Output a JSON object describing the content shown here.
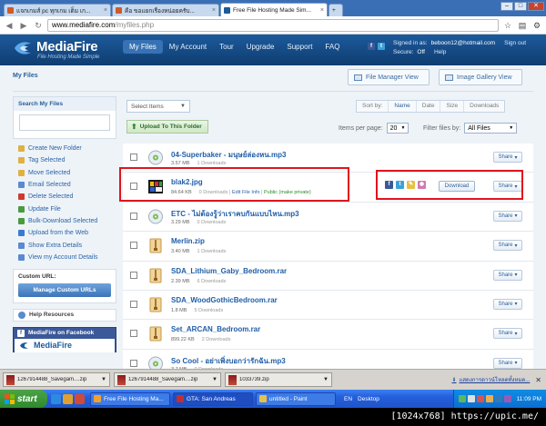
{
  "browser": {
    "tabs": [
      {
        "label": "แจกเกมส์ pc ทุกเกม เต็ม เก...",
        "icon": "forum-icon",
        "color": "#d05a2a"
      },
      {
        "label": "คือ ขอแยกเรื่องหน่อยครับ...",
        "icon": "forum-icon",
        "color": "#d05a2a"
      },
      {
        "label": "Free File Hosting Made Sim...",
        "icon": "mediafire-icon",
        "color": "#1c5a9c"
      }
    ],
    "url_host": "www.mediafire.com",
    "url_path": "/myfiles.php",
    "window_buttons": {
      "minimize": "–",
      "maximize": "□",
      "close": "✕"
    }
  },
  "header": {
    "logo_name": "MediaFire",
    "logo_tagline": "File Hosting Made Simple",
    "nav": [
      "My Files",
      "My Account",
      "Tour",
      "Upgrade",
      "Support",
      "FAQ"
    ],
    "active_nav": "My Files",
    "signed_in_label": "Signed in as:",
    "signed_in_email": "beboon12@hotmail.com",
    "sign_out": "Sign out",
    "secure_label": "Secure:",
    "secure_value": "Off",
    "help": "Help"
  },
  "page": {
    "title": "My Files",
    "file_manager_view": "File Manager View",
    "image_gallery_view": "Image Gallery View"
  },
  "sidebar": {
    "search_label": "Search My Files",
    "actions": [
      {
        "label": "Create New Folder",
        "color": "#e0b040"
      },
      {
        "label": "Tag Selected",
        "color": "#e0b040"
      },
      {
        "label": "Move Selected",
        "color": "#e0b040"
      },
      {
        "label": "Email Selected",
        "color": "#5a8ad0"
      },
      {
        "label": "Delete Selected",
        "color": "#d03a2a"
      },
      {
        "label": "Update File",
        "color": "#4a9a40"
      },
      {
        "label": "Bulk-Download Selected",
        "color": "#4a9a40"
      },
      {
        "label": "Upload from the Web",
        "color": "#3a7ad0"
      },
      {
        "label": "Show Extra Details",
        "color": "#5a8ad0"
      },
      {
        "label": "View my Account Details",
        "color": "#5a8ad0"
      }
    ],
    "custom_url_label": "Custom URL:",
    "custom_url_button": "Manage Custom URLs",
    "help_resources": "Help Resources",
    "facebook_label": "MediaFire on Facebook",
    "facebook_brand": "MediaFire"
  },
  "toolbar": {
    "select_items": "Select Items",
    "upload": "Upload To This Folder",
    "sort_by": "Sort by:",
    "sort_options": [
      "Name",
      "Date",
      "Size",
      "Downloads"
    ],
    "items_per_page_label": "Items per page:",
    "items_per_page": "20",
    "filter_label": "Filter files by:",
    "filter_value": "All Files"
  },
  "files": [
    {
      "name": "04-Superbaker - มนุษย์ล่องหน.mp3",
      "size": "3.57 MB",
      "downloads": "1 Downloads",
      "type": "mp3",
      "expanded": false
    },
    {
      "name": "blak2.jpg",
      "size": "84.64 KB",
      "downloads": "0 Downloads",
      "type": "jpg",
      "expanded": true,
      "edit_label": "Edit File Info",
      "public_label": "Public",
      "make_private": "(make private)",
      "download_label": "Download"
    },
    {
      "name": "ETC - ไม่ต้องรู้ว่าเราคบกันแบบไหน.mp3",
      "size": "3.29 MB",
      "downloads": "0 Downloads",
      "type": "mp3",
      "expanded": false
    },
    {
      "name": "Merlin.zip",
      "size": "3.40 MB",
      "downloads": "1 Downloads",
      "type": "zip",
      "expanded": false
    },
    {
      "name": "SDA_Lithium_Gaby_Bedroom.rar",
      "size": "2.39 MB",
      "downloads": "6 Downloads",
      "type": "zip",
      "expanded": false
    },
    {
      "name": "SDA_WoodGothicBedroom.rar",
      "size": "1.8 MB",
      "downloads": "5 Downloads",
      "type": "zip",
      "expanded": false
    },
    {
      "name": "Set_ARCAN_Bedroom.rar",
      "size": "899.22 KB",
      "downloads": "2 Downloads",
      "type": "zip",
      "expanded": false
    },
    {
      "name": "So Cool - อย่าเพิ่งบอกว่ารักฉัน.mp3",
      "size": "3.7 MB",
      "downloads": "0 Downloads",
      "type": "mp3",
      "expanded": false
    }
  ],
  "share_label": "Share",
  "download_bar": {
    "items": [
      "1267914488_Savegam....zip",
      "1267914488_Savegam....zip",
      "1033739.zip"
    ],
    "show_all": "แสดงการดาวน์โหลดทั้งหมด...",
    "close": "✕"
  },
  "taskbar": {
    "start": "start",
    "windows": [
      {
        "label": "Free File Hosting Ma...",
        "color": "#f0a030"
      },
      {
        "label": "GTA: San Andreas",
        "color": "#c03030"
      },
      {
        "label": "untitled - Paint",
        "color": "#e8c050"
      }
    ],
    "lang": "EN",
    "desktop": "Desktop",
    "clock": "11:09 PM"
  },
  "watermark": "[1024x768] https://upic.me/"
}
